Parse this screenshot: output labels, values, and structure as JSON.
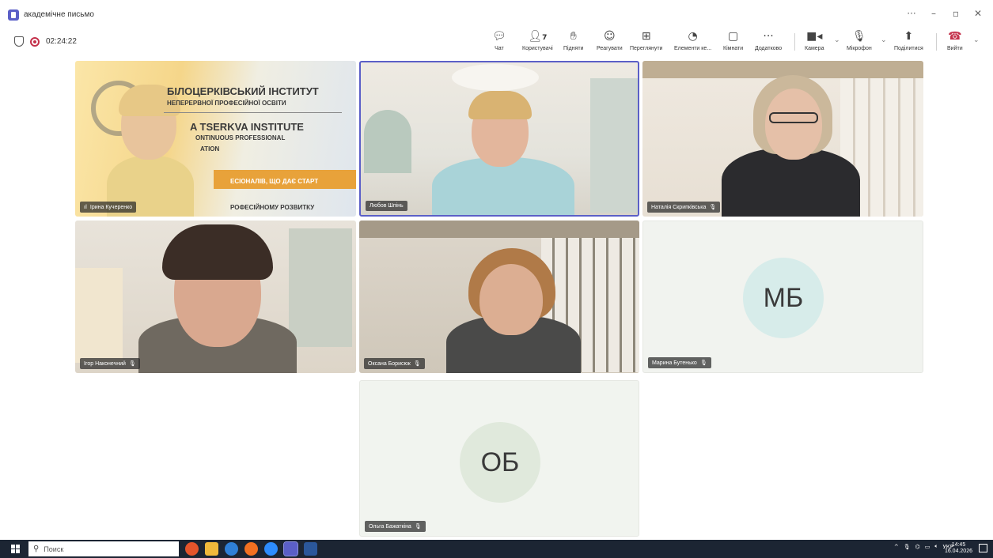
{
  "window": {
    "title": "академічне письмо"
  },
  "meeting": {
    "timer": "02:24:22"
  },
  "toolbar": {
    "chat": "Чат",
    "people": "Користувачі",
    "people_count": "7",
    "raise": "Підняти",
    "react": "Реагувати",
    "view": "Переглянути",
    "apps": "Елементи ке...",
    "rooms": "Кімнати",
    "more": "Додатково",
    "camera": "Камера",
    "mic": "Мікрофон",
    "share": "Поділитися",
    "leave": "Вийти"
  },
  "participants": [
    {
      "name": "Ірина Кучеренко",
      "muted": false
    },
    {
      "name": "Любов Шпінь",
      "muted": false
    },
    {
      "name": "Наталія Скрипківська",
      "muted": true
    },
    {
      "name": "Ігор Наконечний",
      "muted": true
    },
    {
      "name": "Оксана Борисюк",
      "muted": true
    },
    {
      "name": "Марина Бутенько",
      "muted": true,
      "initials": "МБ"
    },
    {
      "name": "Ольга Бажаткіна",
      "muted": true,
      "initials": "ОБ"
    }
  ],
  "banner": {
    "line1": "БІЛОЦЕРКІВСЬКИЙ ІНСТИТУТ",
    "line2": "НЕПЕРЕРВНОЇ ПРОФЕСІЙНОЇ ОСВІТИ",
    "line3": "A TSERKVA INSTITUTE",
    "line4": "ONTINUOUS PROFESSIONAL",
    "line5": "ATION",
    "line6": "ЕСІОНАЛІВ, ЩО ДАЄ СТАРТ",
    "line7": "РОФЕСІЙНОМУ РОЗВИТКУ"
  },
  "taskbar": {
    "search_placeholder": "Поиск",
    "lang": "УКР",
    "time": "14:45",
    "date": "16.04.2026"
  },
  "colors": {
    "accent": "#5b5fc7",
    "leave": "#c4314b",
    "taskbar": "#1c2533"
  }
}
